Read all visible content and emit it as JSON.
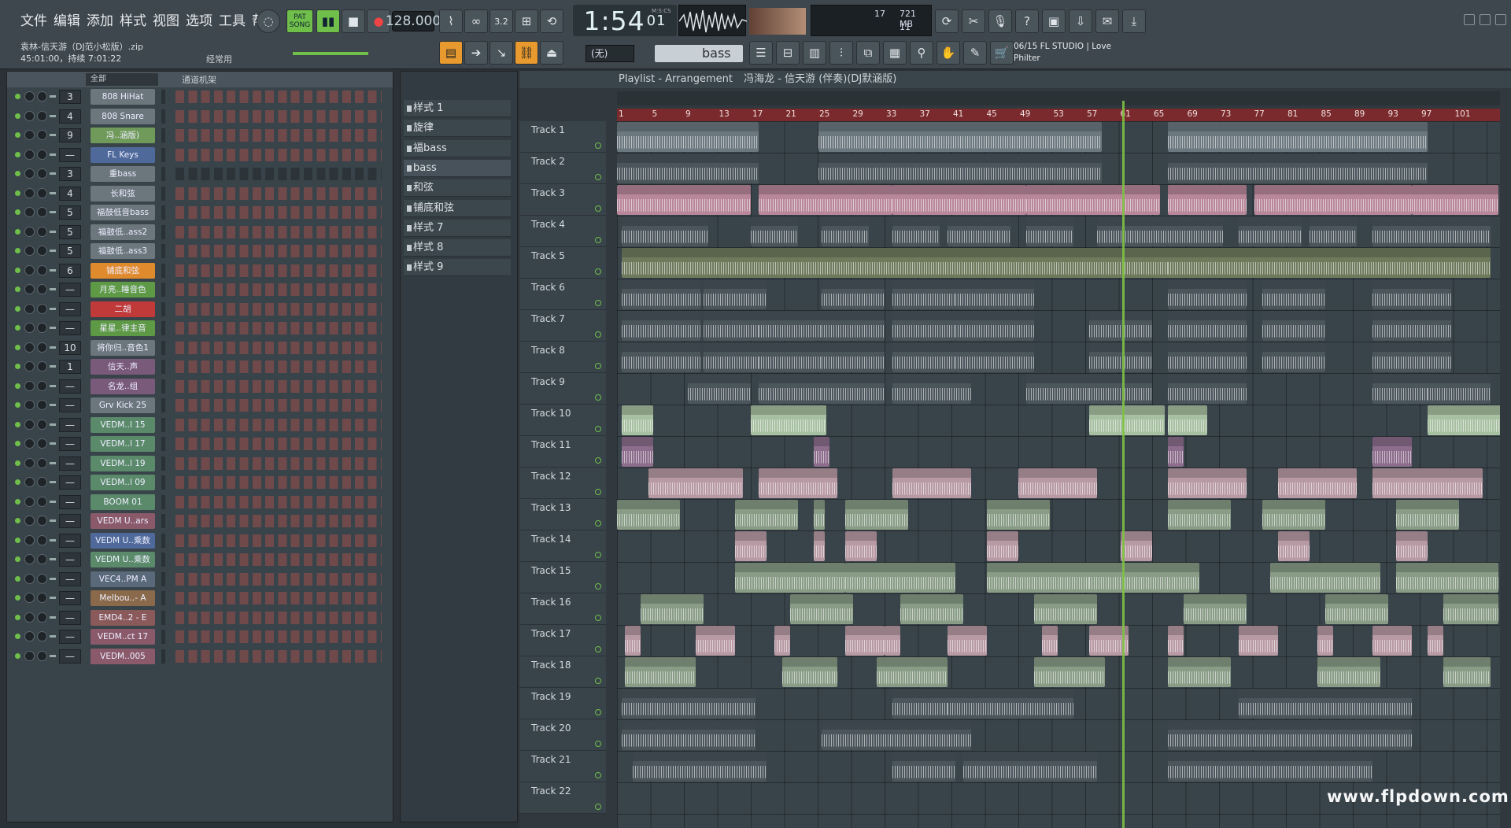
{
  "menu": [
    "文件",
    "编辑",
    "添加",
    "样式",
    "视图",
    "选项",
    "工具",
    "帮助"
  ],
  "song": {
    "file": "袁林-信天游（DJ范小松版）.zip",
    "position": "45:01:00，持续 7:01:22",
    "hint": "经常用"
  },
  "transport": {
    "mode": "SONG",
    "pat_label": "PAT",
    "tempo": "128.000",
    "time_main": "1:54",
    "time_sub": "01",
    "time_label": "M:S:CS"
  },
  "cpu": {
    "voices": "17",
    "mem": "721 MB",
    "cpu": "11"
  },
  "tool": {
    "none": "(无)",
    "pattern": "bass"
  },
  "news": {
    "line1": "06/15  FL STUDIO | Love",
    "line2": "Philter"
  },
  "rack": {
    "filter": "全部",
    "title": "通道机架"
  },
  "channels": [
    {
      "num": "3",
      "name": "808 HiHat",
      "color": "#6b767d"
    },
    {
      "num": "4",
      "name": "808 Snare",
      "color": "#6b767d"
    },
    {
      "num": "9",
      "name": "冯..涵版)",
      "color": "#6f9a5a"
    },
    {
      "num": "—",
      "name": "FL Keys",
      "color": "#4f6a9a"
    },
    {
      "num": "3",
      "name": "重bass",
      "color": "#6b767d"
    },
    {
      "num": "4",
      "name": "长和弦",
      "color": "#6b767d"
    },
    {
      "num": "5",
      "name": "福鼓低音bass",
      "color": "#6b767d"
    },
    {
      "num": "5",
      "name": "福鼓低..ass2",
      "color": "#6b767d"
    },
    {
      "num": "5",
      "name": "福鼓低..ass3",
      "color": "#6b767d"
    },
    {
      "num": "6",
      "name": "铺底和弦",
      "color": "#e08a2e"
    },
    {
      "num": "—",
      "name": "月亮..睡音色",
      "color": "#5e9a46"
    },
    {
      "num": "—",
      "name": "二胡",
      "color": "#c03a3a"
    },
    {
      "num": "—",
      "name": "星星..律主音",
      "color": "#5e9a46"
    },
    {
      "num": "10",
      "name": "将你归..音色1",
      "color": "#6b767d"
    },
    {
      "num": "1",
      "name": "信天..声",
      "color": "#7a5a7a"
    },
    {
      "num": "—",
      "name": "名龙..组",
      "color": "#7a5a7a"
    },
    {
      "num": "—",
      "name": "Grv Kick 25",
      "color": "#6b767d"
    },
    {
      "num": "—",
      "name": "VEDM..l 15",
      "color": "#5a8a6a"
    },
    {
      "num": "—",
      "name": "VEDM..l 17",
      "color": "#5a8a6a"
    },
    {
      "num": "—",
      "name": "VEDM..l 19",
      "color": "#5a8a6a"
    },
    {
      "num": "—",
      "name": "VEDM..l 09",
      "color": "#5a8a6a"
    },
    {
      "num": "—",
      "name": "BOOM 01",
      "color": "#5a8a6a"
    },
    {
      "num": "—",
      "name": "VEDM U..ars",
      "color": "#8a5a6a"
    },
    {
      "num": "—",
      "name": "VEDM U..乘数",
      "color": "#4f6a9a"
    },
    {
      "num": "—",
      "name": "VEDM U..乘数",
      "color": "#5a8a6a"
    },
    {
      "num": "—",
      "name": "VEC4..PM A",
      "color": "#5a6a7a"
    },
    {
      "num": "—",
      "name": "Melbou..- A",
      "color": "#8a6a4a"
    },
    {
      "num": "—",
      "name": "EMD4..2 - E",
      "color": "#8a5a5a"
    },
    {
      "num": "—",
      "name": "VEDM..ct 17",
      "color": "#8a5a6a"
    },
    {
      "num": "—",
      "name": "VEDM..005",
      "color": "#8a5a6a"
    }
  ],
  "patterns": [
    "样式 1",
    "旋律",
    "福bass",
    "bass",
    "和弦",
    "铺底和弦",
    "样式 7",
    "样式 8",
    "样式 9"
  ],
  "playlist": {
    "title": "Playlist - Arrangement",
    "breadcrumb": "冯海龙 - 信天游 (伴奏)(DJ默涵版)"
  },
  "ruler": [
    "1",
    "5",
    "9",
    "13",
    "17",
    "21",
    "25",
    "29",
    "33",
    "37",
    "41",
    "45",
    "49",
    "53",
    "57",
    "61",
    "65",
    "69",
    "73",
    "77",
    "81",
    "85",
    "89",
    "93",
    "97",
    "101"
  ],
  "tracks": [
    "Track 1",
    "Track 2",
    "Track 3",
    "Track 4",
    "Track 5",
    "Track 6",
    "Track 7",
    "Track 8",
    "Track 9",
    "Track 10",
    "Track 11",
    "Track 12",
    "Track 13",
    "Track 14",
    "Track 15",
    "Track 16",
    "Track 17",
    "Track 18",
    "Track 19",
    "Track 20",
    "Track 21",
    "Track 22"
  ],
  "watermark": "www.flpdown.com"
}
